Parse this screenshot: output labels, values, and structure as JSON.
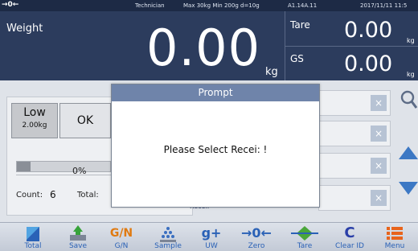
{
  "status_bar": {
    "zero_indicator": "→0←",
    "user_role": "Technician",
    "scale_spec": "Max 30kg  Min 200g  d=10g",
    "code": "A1.14A.11",
    "date": "2017/11/11  11:5"
  },
  "display": {
    "weight_label": "Weight",
    "weight_value": "0.00",
    "weight_unit": "kg",
    "tare_label": "Tare",
    "tare_value": "0.00",
    "tare_unit": "kg",
    "gs_label": "GS",
    "gs_value": "0.00",
    "gs_unit": "kg"
  },
  "panel": {
    "low_label": "Low",
    "low_value": "2.00kg",
    "ok_label": "OK",
    "progress_percent": "0%",
    "progress_fraction": 0.15,
    "count_label": "Count:",
    "count_value": "6",
    "total_label": "Total:",
    "recei_label": "Recei:"
  },
  "fields": {
    "clear_symbol": "×"
  },
  "modal": {
    "title": "Prompt",
    "message": "Please Select  Recei: !"
  },
  "toolbar": [
    {
      "label": "Total",
      "icon": "total-icon"
    },
    {
      "label": "Save",
      "icon": "save-icon"
    },
    {
      "label": "G/N",
      "icon": "gn-icon"
    },
    {
      "label": "Sample",
      "icon": "sample-icon"
    },
    {
      "label": "UW",
      "icon": "uw-icon"
    },
    {
      "label": "Zero",
      "icon": "zero-icon"
    },
    {
      "label": "Tare",
      "icon": "tare-icon"
    },
    {
      "label": "Clear ID",
      "icon": "clear-id-icon"
    },
    {
      "label": "Menu",
      "icon": "menu-icon"
    }
  ],
  "colors": {
    "display_bg": "#2c3c5d",
    "accent_blue": "#3c78c4",
    "toolbar_label": "#2a61b6"
  }
}
